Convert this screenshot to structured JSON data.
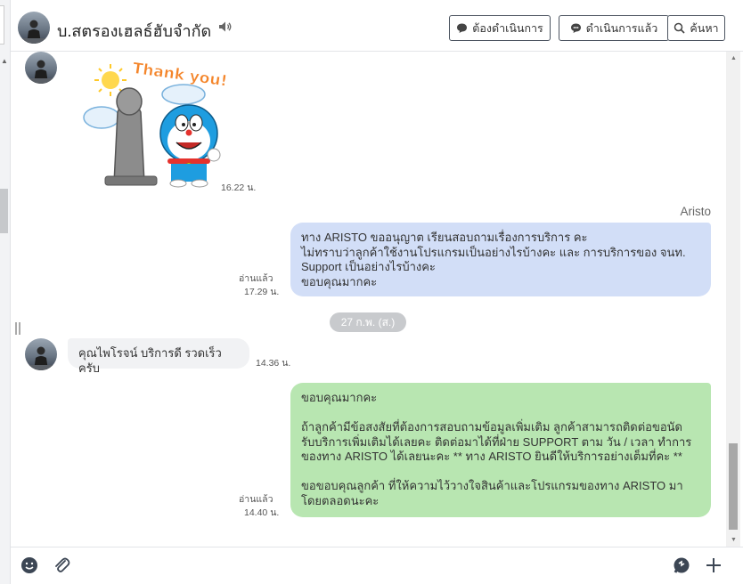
{
  "header": {
    "title": "บ.สตรองเฮลธ์ฮับจำกัด",
    "buttons": {
      "todo": "ต้องดำเนินการ",
      "done": "ดำเนินการแล้ว",
      "search": "ค้นหา"
    }
  },
  "messages": [
    {
      "type": "sticker",
      "direction": "incoming",
      "sticker_text": "Thank you!",
      "time": "16.22 น."
    },
    {
      "type": "text",
      "direction": "outgoing",
      "sender": "Aristo",
      "read": "อ่านแล้ว",
      "time": "17.29 น.",
      "text": "ทาง ARISTO ขออนุญาต เรียนสอบถามเรื่องการบริการ คะ\nไม่ทราบว่าลูกค้าใช้งานโปรแกรมเป็นอย่างไรบ้างคะ และ การบริการของ จนท.\nSupport เป็นอย่างไรบ้างคะ\nขอบคุณมากคะ"
    },
    {
      "type": "date",
      "text": "27 ก.พ. (ส.)"
    },
    {
      "type": "text",
      "direction": "incoming",
      "time": "14.36 น.",
      "text": "คุณไพโรจน์ บริการดี รวดเร็วครับ"
    },
    {
      "type": "text",
      "direction": "outgoing",
      "read": "อ่านแล้ว",
      "time": "14.40 น.",
      "text": "ขอบคุณมากคะ\n\nถ้าลูกค้ามีข้อสงสัยที่ต้องการสอบถามข้อมูลเพิ่มเติม ลูกค้าสามารถติดต่อขอนัด\nรับบริการเพิ่มเติมได้เลยคะ ติดต่อมาได้ที่ฝ่าย SUPPORT ตาม วัน / เวลา ทำการ\nของทาง ARISTO ได้เลยนะคะ ** ทาง ARISTO ยินดีให้บริการอย่างเต็มที่คะ **\n\nขอขอบคุณลูกค้า ที่ให้ความไว้วางใจสินค้าและโปรแกรมของทาง ARISTO มา\nโดยตลอดนะคะ"
    }
  ],
  "icons": {
    "header_speaker": "speaker-icon",
    "btn_todo": "chat-bubble-icon",
    "btn_done": "chat-bubble-dots-icon",
    "btn_search": "search-icon",
    "footer_emoji": "emoji-icon",
    "footer_attach": "paperclip-icon",
    "footer_quick": "quick-reply-icon",
    "footer_plus": "plus-icon"
  },
  "colors": {
    "outgoing_bubble": "#d2def7",
    "outgoing_bubble_2": "#b8e6b1",
    "incoming_bubble": "#f1f2f4",
    "date_pill": "#c8cacd"
  }
}
